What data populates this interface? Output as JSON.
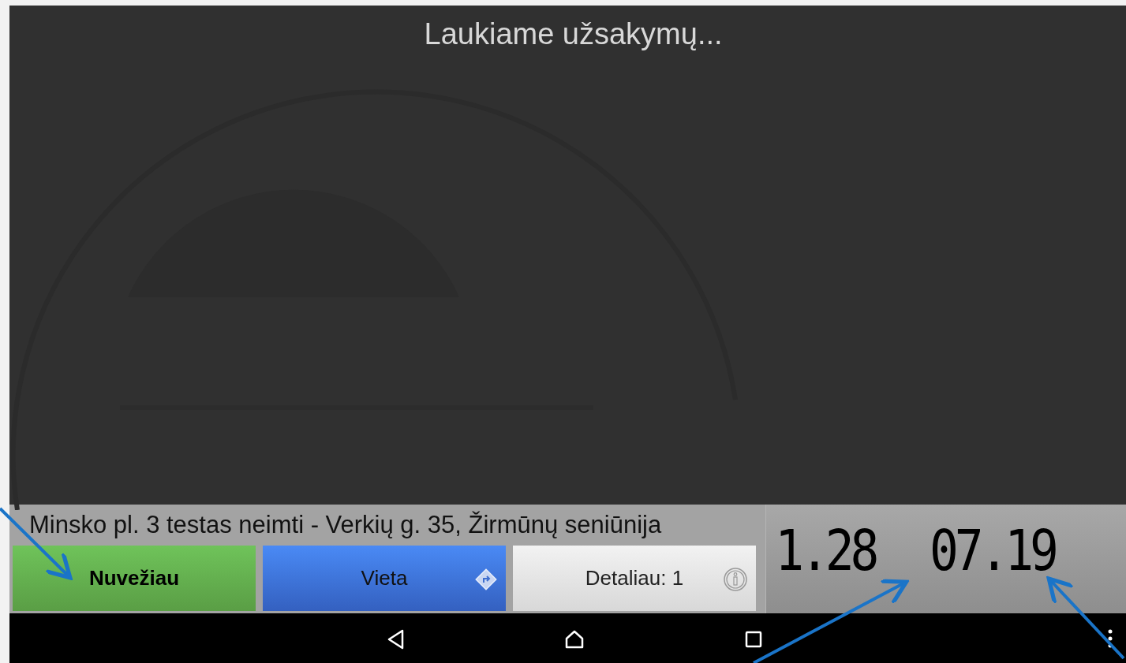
{
  "status_title": "Laukiame užsakymų...",
  "order_address": "Minsko pl. 3 testas neimti - Verkių g. 35, Žirmūnų seniūnija",
  "buttons": [
    {
      "kind": "done",
      "label": "Nuvežiau"
    },
    {
      "kind": "location",
      "label": "Vieta"
    },
    {
      "kind": "details",
      "label": "Detaliau: 1"
    }
  ],
  "meters": [
    "1.28",
    "07.19"
  ]
}
